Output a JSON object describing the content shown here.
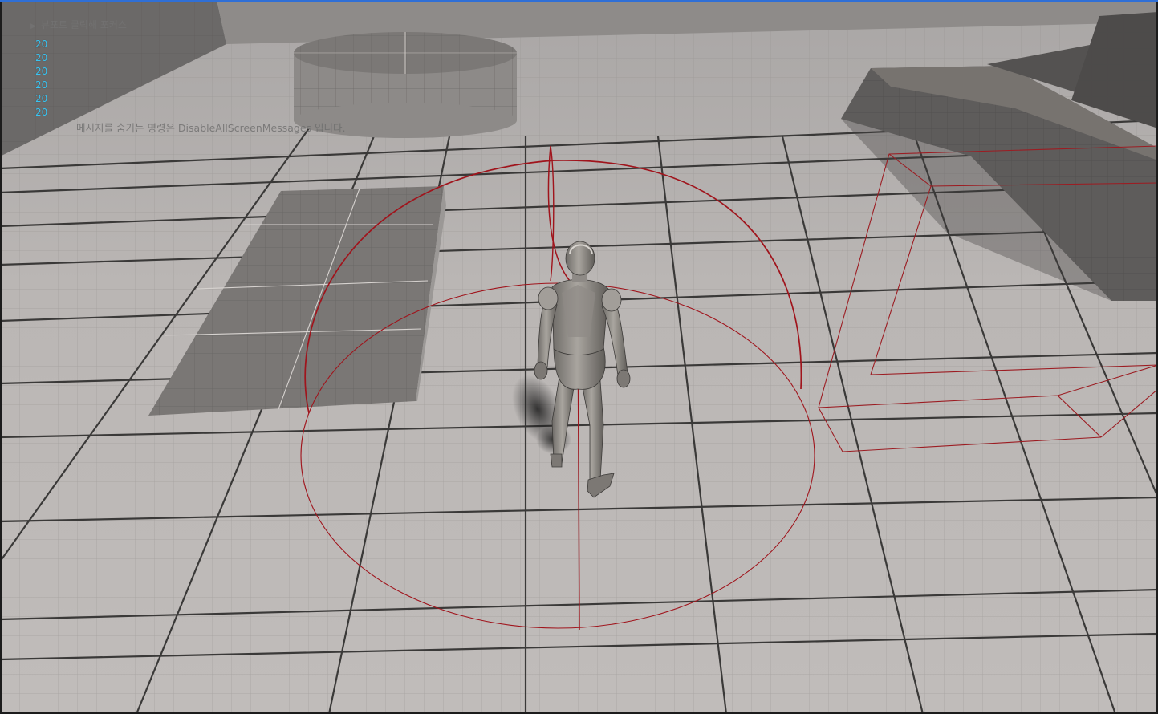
{
  "viewport": {
    "play_hint": "뷰포트 클릭해 포커스",
    "screen_messages": [
      "20",
      "20",
      "20",
      "20",
      "20",
      "20"
    ],
    "disable_messages_hint": "메시지를 숨기는 명령은 DisableAllScreenMessages 입니다."
  },
  "colors": {
    "accent_bar": "#2f6fd6",
    "debug_text": "#39c4f2",
    "debug_collision": "#a0141c",
    "floor": "#b9b5b3"
  },
  "icons": {
    "play_hint": "triangle-right-icon"
  }
}
